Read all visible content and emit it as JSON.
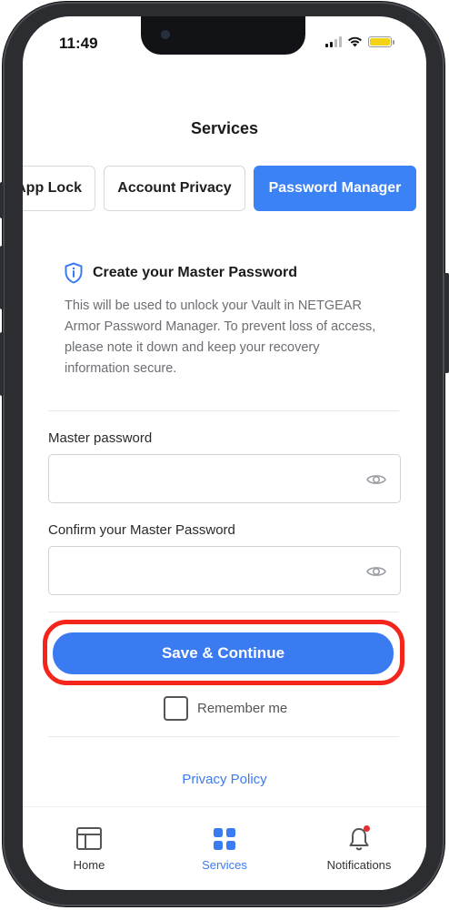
{
  "status_bar": {
    "time": "11:49"
  },
  "header": {
    "title": "Services"
  },
  "tabs": [
    {
      "label": "App Lock",
      "active": false
    },
    {
      "label": "Account Privacy",
      "active": false
    },
    {
      "label": "Password Manager",
      "active": true
    }
  ],
  "info": {
    "title": "Create your Master Password",
    "text": "This will be used to unlock your Vault in NETGEAR Armor Password Manager. To prevent loss of access, please note it down and keep your recovery information secure."
  },
  "form": {
    "password_label": "Master password",
    "password_value": "",
    "confirm_label": "Confirm your Master Password",
    "confirm_value": ""
  },
  "cta": {
    "label": "Save & Continue"
  },
  "remember": {
    "label": "Remember me",
    "checked": false
  },
  "privacy_link": "Privacy Policy",
  "tabbar": {
    "items": [
      {
        "label": "Home",
        "icon": "home-icon",
        "active": false
      },
      {
        "label": "Services",
        "icon": "grid-icon",
        "active": true
      },
      {
        "label": "Notifications",
        "icon": "bell-icon",
        "active": false
      }
    ]
  },
  "colors": {
    "accent": "#3b7bf2",
    "highlight": "#f4261c"
  }
}
